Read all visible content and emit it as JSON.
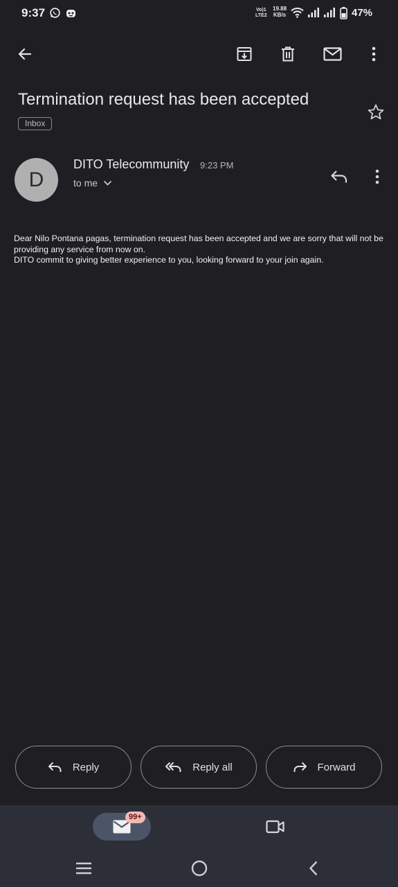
{
  "status_bar": {
    "time": "9:37",
    "network_tag_line1": "Vo)1",
    "network_tag_line2": "LTE2",
    "speed_value": "19.88",
    "speed_unit": "KB/s",
    "battery_percent": "47%",
    "icons": [
      "whatsapp-icon",
      "notification-app-icon",
      "wifi-icon",
      "signal-1-icon",
      "signal-2-icon",
      "battery-icon"
    ]
  },
  "toolbar": {
    "icons": [
      "back-arrow-icon",
      "archive-icon",
      "delete-icon",
      "mark-unread-icon",
      "more-vert-icon"
    ]
  },
  "email": {
    "subject": "Termination request has been accepted",
    "label": "Inbox",
    "sender_initial": "D",
    "sender_name": "DITO Telecommunity",
    "time": "9:23 PM",
    "recipient": "to me",
    "body_line1": "Dear Nilo Pontana pagas, termination request has been accepted and we are sorry that  will not be providing any service from now on.",
    "body_line2": "DITO commit to giving better experience to you, looking forward to your join again."
  },
  "actions": {
    "reply": "Reply",
    "reply_all": "Reply all",
    "forward": "Forward"
  },
  "bottom_nav": {
    "mail_badge": "99+",
    "items": [
      "mail-icon",
      "meet-video-icon"
    ]
  },
  "system_nav": [
    "recents-icon",
    "home-icon",
    "back-icon"
  ],
  "colors": {
    "background": "#1f1f23",
    "bottom_bar": "#2d2f38",
    "active_pill": "#4c5468",
    "badge": "#f2b8b5"
  }
}
